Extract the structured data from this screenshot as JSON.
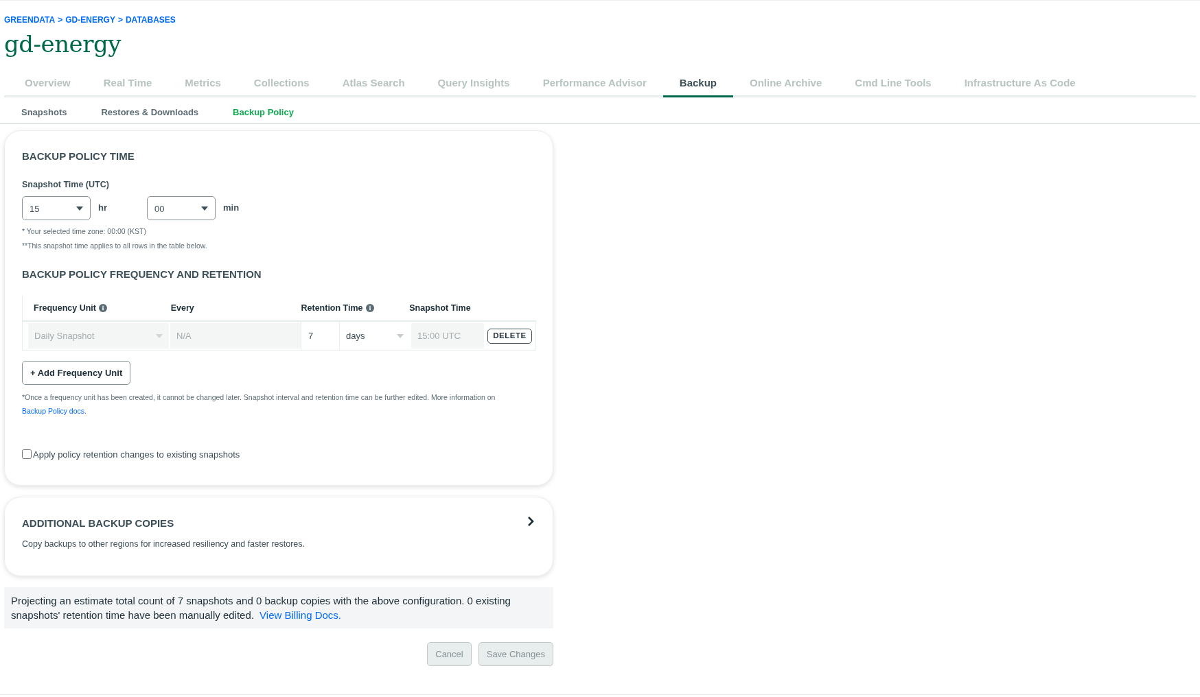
{
  "breadcrumbs": [
    "GREENDATA",
    "GD-ENERGY",
    "DATABASES"
  ],
  "breadcrumb_separator": ">",
  "title": "gd-energy",
  "tabs": [
    {
      "label": "Overview",
      "selected": false
    },
    {
      "label": "Real Time",
      "selected": false
    },
    {
      "label": "Metrics",
      "selected": false
    },
    {
      "label": "Collections",
      "selected": false
    },
    {
      "label": "Atlas Search",
      "selected": false
    },
    {
      "label": "Query Insights",
      "selected": false
    },
    {
      "label": "Performance Advisor",
      "selected": false
    },
    {
      "label": "Backup",
      "selected": true
    },
    {
      "label": "Online Archive",
      "selected": false
    },
    {
      "label": "Cmd Line Tools",
      "selected": false
    },
    {
      "label": "Infrastructure As Code",
      "selected": false
    }
  ],
  "subtabs": [
    {
      "label": "Snapshots",
      "selected": false
    },
    {
      "label": "Restores & Downloads",
      "selected": false
    },
    {
      "label": "Backup Policy",
      "selected": true
    }
  ],
  "policy_time": {
    "heading": "BACKUP POLICY TIME",
    "label": "Snapshot Time (UTC)",
    "hour": {
      "value": "15",
      "unit": "hr"
    },
    "minute": {
      "value": "00",
      "unit": "min"
    },
    "notes": [
      "* Your selected time zone: 00:00 (KST)",
      "**This snapshot time applies to all rows in the table below."
    ]
  },
  "frequency": {
    "heading": "BACKUP POLICY FREQUENCY AND RETENTION",
    "columns": [
      {
        "label": "Frequency Unit",
        "info": true
      },
      {
        "label": "Every",
        "info": false
      },
      {
        "label": "Retention Time",
        "info": true
      },
      {
        "label": "Snapshot Time",
        "info": false
      }
    ],
    "rows": [
      {
        "frequency_unit": "Daily Snapshot",
        "every": "N/A",
        "retention_value": "7",
        "retention_unit": "days",
        "snapshot_time": "15:00 UTC",
        "delete": "DELETE",
        "disabled": true
      }
    ],
    "add_button": "+ Add Frequency Unit",
    "note": "*Once a frequency unit has been created, it cannot be changed later. Snapshot interval and retention time can be further edited. More information on ",
    "note_link": "Backup Policy docs",
    "note_end": ".",
    "apply_checkbox": {
      "label": "Apply policy retention changes to existing snapshots",
      "checked": false
    }
  },
  "copies": {
    "heading": "ADDITIONAL BACKUP COPIES",
    "description": "Copy backups to other regions for increased resiliency and faster restores.",
    "expanded": false
  },
  "estimate": {
    "text": "Projecting an estimate total count of 7 snapshots and 0 backup copies with the above configuration. 0 existing snapshots' retention time have been manually edited.",
    "link": "View Billing Docs."
  },
  "actions": [
    {
      "label": "Cancel",
      "disabled": true
    },
    {
      "label": "Save Changes",
      "disabled": true
    }
  ]
}
